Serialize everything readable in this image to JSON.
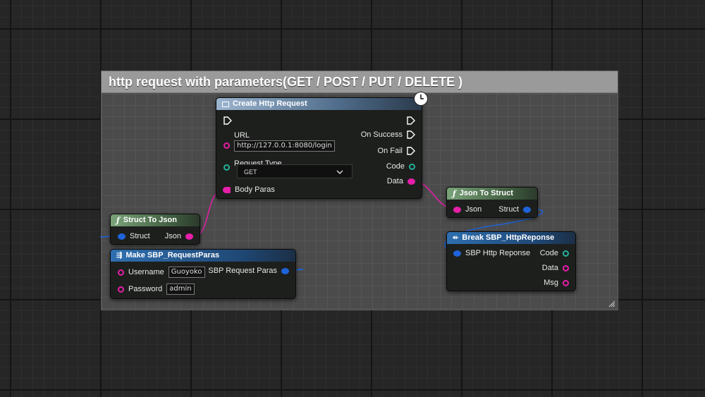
{
  "comment": {
    "title": "http request with parameters(GET / POST / PUT / DELETE )"
  },
  "nodes": {
    "create_http_request": {
      "title": "Create Http Request",
      "url_label": "URL",
      "url_value": "http://127.0.0.1:8080/login",
      "request_type_label": "Request Type",
      "request_type_value": "GET",
      "body_paras_label": "Body Paras",
      "on_success_label": "On Success",
      "on_fail_label": "On Fail",
      "code_label": "Code",
      "data_label": "Data",
      "icon": "clock-icon"
    },
    "struct_to_json": {
      "title": "Struct To Json",
      "struct_label": "Struct",
      "json_label": "Json"
    },
    "make_request_paras": {
      "title": "Make SBP_RequestParas",
      "username_label": "Username",
      "username_value": "Guoyoko",
      "password_label": "Password",
      "password_value": "admin",
      "output_label": "SBP Request Paras"
    },
    "json_to_struct": {
      "title": "Json To Struct",
      "json_label": "Json",
      "struct_label": "Struct"
    },
    "break_http_response": {
      "title": "Break SBP_HttpReponse",
      "input_label": "SBP Http Reponse",
      "code_label": "Code",
      "data_label": "Data",
      "msg_label": "Msg"
    }
  },
  "colors": {
    "string_pin": "#e61ea8",
    "struct_pin": "#1e63d8",
    "int_pin": "#22b39b",
    "exec_pin": "#ffffff"
  }
}
